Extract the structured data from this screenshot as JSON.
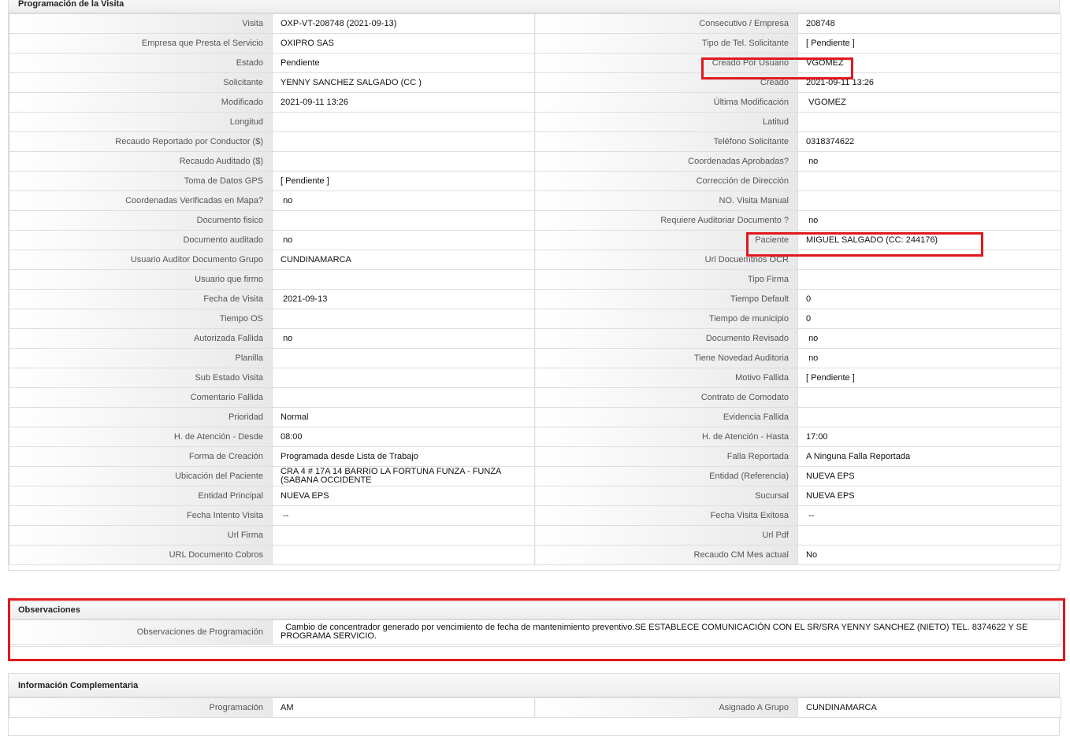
{
  "programacion": {
    "title": "Programación de la Visita",
    "rows": [
      [
        {
          "label": "Visita",
          "value": "OXP-VT-208748 (2021-09-13)"
        },
        {
          "label": "Consecutivo / Empresa",
          "value": "208748"
        }
      ],
      [
        {
          "label": "Empresa que Presta el Servicio",
          "value": "OXIPRO SAS"
        },
        {
          "label": "Tipo de Tel. Solicitante",
          "value": "[ Pendiente ]"
        }
      ],
      [
        {
          "label": "Estado",
          "value": "Pendiente"
        },
        {
          "label": "Creado Por Usuario",
          "value": "VGOMEZ"
        }
      ],
      [
        {
          "label": "Solicitante",
          "value": "YENNY SANCHEZ SALGADO (CC )"
        },
        {
          "label": "Creado",
          "value": "2021-09-11 13:26"
        }
      ],
      [
        {
          "label": "Modificado",
          "value": "2021-09-11 13:26"
        },
        {
          "label": "Última Modificación",
          "value": " VGOMEZ"
        }
      ],
      [
        {
          "label": "Longitud",
          "value": ""
        },
        {
          "label": "Latitud",
          "value": ""
        }
      ],
      [
        {
          "label": "Recaudo Reportado por Conductor ($)",
          "value": ""
        },
        {
          "label": "Teléfono Solicitante",
          "value": "0318374622"
        }
      ],
      [
        {
          "label": "Recaudo Auditado ($)",
          "value": ""
        },
        {
          "label": "Coordenadas Aprobadas?",
          "value": " no"
        }
      ],
      [
        {
          "label": "Toma de Datos GPS",
          "value": "[ Pendiente ]"
        },
        {
          "label": "Corrección de Dirección",
          "value": ""
        }
      ],
      [
        {
          "label": "Coordenadas Verificadas en Mapa?",
          "value": " no"
        },
        {
          "label": "NO. Visita Manual",
          "value": ""
        }
      ],
      [
        {
          "label": "Documento fisico",
          "value": ""
        },
        {
          "label": "Requiere Auditoriar Documento ?",
          "value": " no"
        }
      ],
      [
        {
          "label": "Documento auditado",
          "value": " no"
        },
        {
          "label": "Paciente",
          "value": "MIGUEL SALGADO (CC: 244176)"
        }
      ],
      [
        {
          "label": "Usuario Auditor Documento Grupo",
          "value": "CUNDINAMARCA"
        },
        {
          "label": "Url Docuemtnos OCR",
          "value": ""
        }
      ],
      [
        {
          "label": "Usuario que firmo",
          "value": ""
        },
        {
          "label": "Tipo Firma",
          "value": ""
        }
      ],
      [
        {
          "label": "Fecha de Visita",
          "value": " 2021-09-13"
        },
        {
          "label": "Tiempo Default",
          "value": "0"
        }
      ],
      [
        {
          "label": "Tiempo OS",
          "value": ""
        },
        {
          "label": "Tiempo de municipio",
          "value": "0"
        }
      ],
      [
        {
          "label": "Autorizada Fallida",
          "value": " no"
        },
        {
          "label": "Documento Revisado",
          "value": " no"
        }
      ],
      [
        {
          "label": "Planilla",
          "value": ""
        },
        {
          "label": "Tiene Novedad Auditoria",
          "value": " no"
        }
      ],
      [
        {
          "label": "Sub Estado Visita",
          "value": ""
        },
        {
          "label": "Motivo Fallida",
          "value": "[ Pendiente ]"
        }
      ],
      [
        {
          "label": "Comentario Fallida",
          "value": ""
        },
        {
          "label": "Contrato de Comodato",
          "value": ""
        }
      ],
      [
        {
          "label": "Prioridad",
          "value": "Normal"
        },
        {
          "label": "Evidencia Fallida",
          "value": ""
        }
      ],
      [
        {
          "label": "H. de Atención - Desde",
          "value": "08:00"
        },
        {
          "label": "H. de Atención - Hasta",
          "value": "17:00"
        }
      ],
      [
        {
          "label": "Forma de Creación",
          "value": "Programada desde Lista de Trabajo"
        },
        {
          "label": "Falla Reportada",
          "value": "A Ninguna Falla Reportada"
        }
      ],
      [
        {
          "label": "Ubicación del Paciente",
          "value": "CRA 4 # 17A 14 BARRIO LA FORTUNA FUNZA - FUNZA (SABANA OCCIDENTE"
        },
        {
          "label": "Entidad (Referencia)",
          "value": "NUEVA EPS"
        }
      ],
      [
        {
          "label": "Entidad Principal",
          "value": "NUEVA EPS"
        },
        {
          "label": "Sucursal",
          "value": "NUEVA EPS"
        }
      ],
      [
        {
          "label": "Fecha Intento Visita",
          "value": " --"
        },
        {
          "label": "Fecha Visita Exitosa",
          "value": " --"
        }
      ],
      [
        {
          "label": "Url Firma",
          "value": ""
        },
        {
          "label": "Url Pdf",
          "value": ""
        }
      ],
      [
        {
          "label": "URL Documento Cobros",
          "value": ""
        },
        {
          "label": "Recaudo CM Mes actual",
          "value": "No"
        }
      ]
    ]
  },
  "observaciones": {
    "title": "Observaciones",
    "label": "Observaciones de Programación",
    "value": "  Cambio de concentrador generado por vencimiento de fecha de mantenimiento preventivo.SE ESTABLECE COMUNICACIÓN CON EL SR/SRA YENNY SANCHEZ (NIETO) TEL. 8374622 Y SE PROGRAMA SERVICIO."
  },
  "complementaria": {
    "title": "Información Complementaria",
    "rows": [
      [
        {
          "label": "Programación",
          "value": "AM"
        },
        {
          "label": "Asignado A Grupo",
          "value": "CUNDINAMARCA"
        }
      ]
    ]
  },
  "colors": {
    "highlight": "#e0181f",
    "header_bg": "#ededed",
    "border": "#dedede"
  }
}
